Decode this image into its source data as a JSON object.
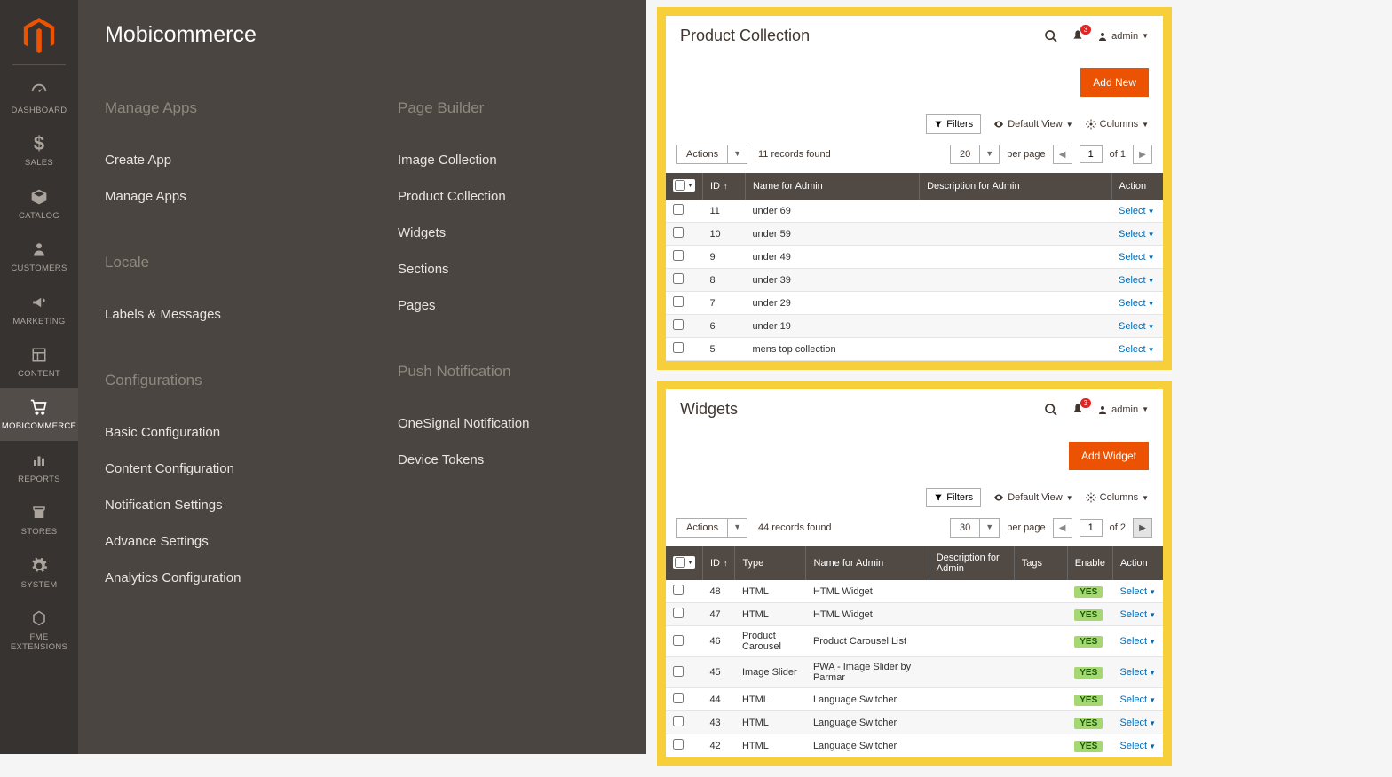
{
  "sidebar": {
    "items": [
      {
        "label": "DASHBOARD",
        "icon": "dashboard"
      },
      {
        "label": "SALES",
        "icon": "dollar"
      },
      {
        "label": "CATALOG",
        "icon": "box"
      },
      {
        "label": "CUSTOMERS",
        "icon": "person"
      },
      {
        "label": "MARKETING",
        "icon": "megaphone"
      },
      {
        "label": "CONTENT",
        "icon": "layout"
      },
      {
        "label": "MOBICOMMERCE",
        "icon": "cart",
        "active": true
      },
      {
        "label": "REPORTS",
        "icon": "reports"
      },
      {
        "label": "STORES",
        "icon": "stores"
      },
      {
        "label": "SYSTEM",
        "icon": "gear"
      },
      {
        "label": "FME EXTENSIONS",
        "icon": "hex"
      }
    ]
  },
  "submenu": {
    "title": "Mobicommerce",
    "sections": {
      "manage_apps": {
        "heading": "Manage Apps",
        "links": [
          "Create App",
          "Manage Apps"
        ]
      },
      "locale": {
        "heading": "Locale",
        "links": [
          "Labels & Messages"
        ]
      },
      "configurations": {
        "heading": "Configurations",
        "links": [
          "Basic Configuration",
          "Content Configuration",
          "Notification Settings",
          "Advance Settings",
          "Analytics Configuration"
        ]
      },
      "page_builder": {
        "heading": "Page Builder",
        "links": [
          "Image Collection",
          "Product Collection",
          "Widgets",
          "Sections",
          "Pages"
        ]
      },
      "push_notification": {
        "heading": "Push Notification",
        "links": [
          "OneSignal Notification",
          "Device Tokens"
        ]
      }
    }
  },
  "panel1": {
    "title": "Product Collection",
    "admin_user": "admin",
    "notif_count": "3",
    "primary_btn": "Add New",
    "filters_label": "Filters",
    "default_view_label": "Default View",
    "columns_label": "Columns",
    "actions_label": "Actions",
    "records_found": "11 records found",
    "per_page_value": "20",
    "per_page_label": "per page",
    "page_value": "1",
    "page_total": "of 1",
    "headers": {
      "id": "ID",
      "name": "Name for Admin",
      "desc": "Description for Admin",
      "action": "Action"
    },
    "action_label": "Select",
    "rows": [
      {
        "id": "11",
        "name": "under 69",
        "desc": ""
      },
      {
        "id": "10",
        "name": "under 59",
        "desc": ""
      },
      {
        "id": "9",
        "name": "under 49",
        "desc": ""
      },
      {
        "id": "8",
        "name": "under 39",
        "desc": ""
      },
      {
        "id": "7",
        "name": "under 29",
        "desc": ""
      },
      {
        "id": "6",
        "name": "under 19",
        "desc": ""
      },
      {
        "id": "5",
        "name": "mens top collection",
        "desc": ""
      }
    ]
  },
  "panel2": {
    "title": "Widgets",
    "admin_user": "admin",
    "notif_count": "3",
    "primary_btn": "Add Widget",
    "filters_label": "Filters",
    "default_view_label": "Default View",
    "columns_label": "Columns",
    "actions_label": "Actions",
    "records_found": "44 records found",
    "per_page_value": "30",
    "per_page_label": "per page",
    "page_value": "1",
    "page_total": "of 2",
    "headers": {
      "id": "ID",
      "type": "Type",
      "name": "Name for Admin",
      "desc": "Description for Admin",
      "tags": "Tags",
      "enable": "Enable",
      "action": "Action"
    },
    "action_label": "Select",
    "enable_yes": "YES",
    "rows": [
      {
        "id": "48",
        "type": "HTML",
        "name": "HTML Widget",
        "desc": "",
        "tags": ""
      },
      {
        "id": "47",
        "type": "HTML",
        "name": "HTML Widget",
        "desc": "",
        "tags": ""
      },
      {
        "id": "46",
        "type": "Product Carousel",
        "name": "Product Carousel List",
        "desc": "",
        "tags": ""
      },
      {
        "id": "45",
        "type": "Image Slider",
        "name": "PWA - Image Slider by Parmar",
        "desc": "",
        "tags": ""
      },
      {
        "id": "44",
        "type": "HTML",
        "name": "Language Switcher",
        "desc": "",
        "tags": ""
      },
      {
        "id": "43",
        "type": "HTML",
        "name": "Language Switcher",
        "desc": "",
        "tags": ""
      },
      {
        "id": "42",
        "type": "HTML",
        "name": "Language Switcher",
        "desc": "",
        "tags": ""
      }
    ]
  }
}
